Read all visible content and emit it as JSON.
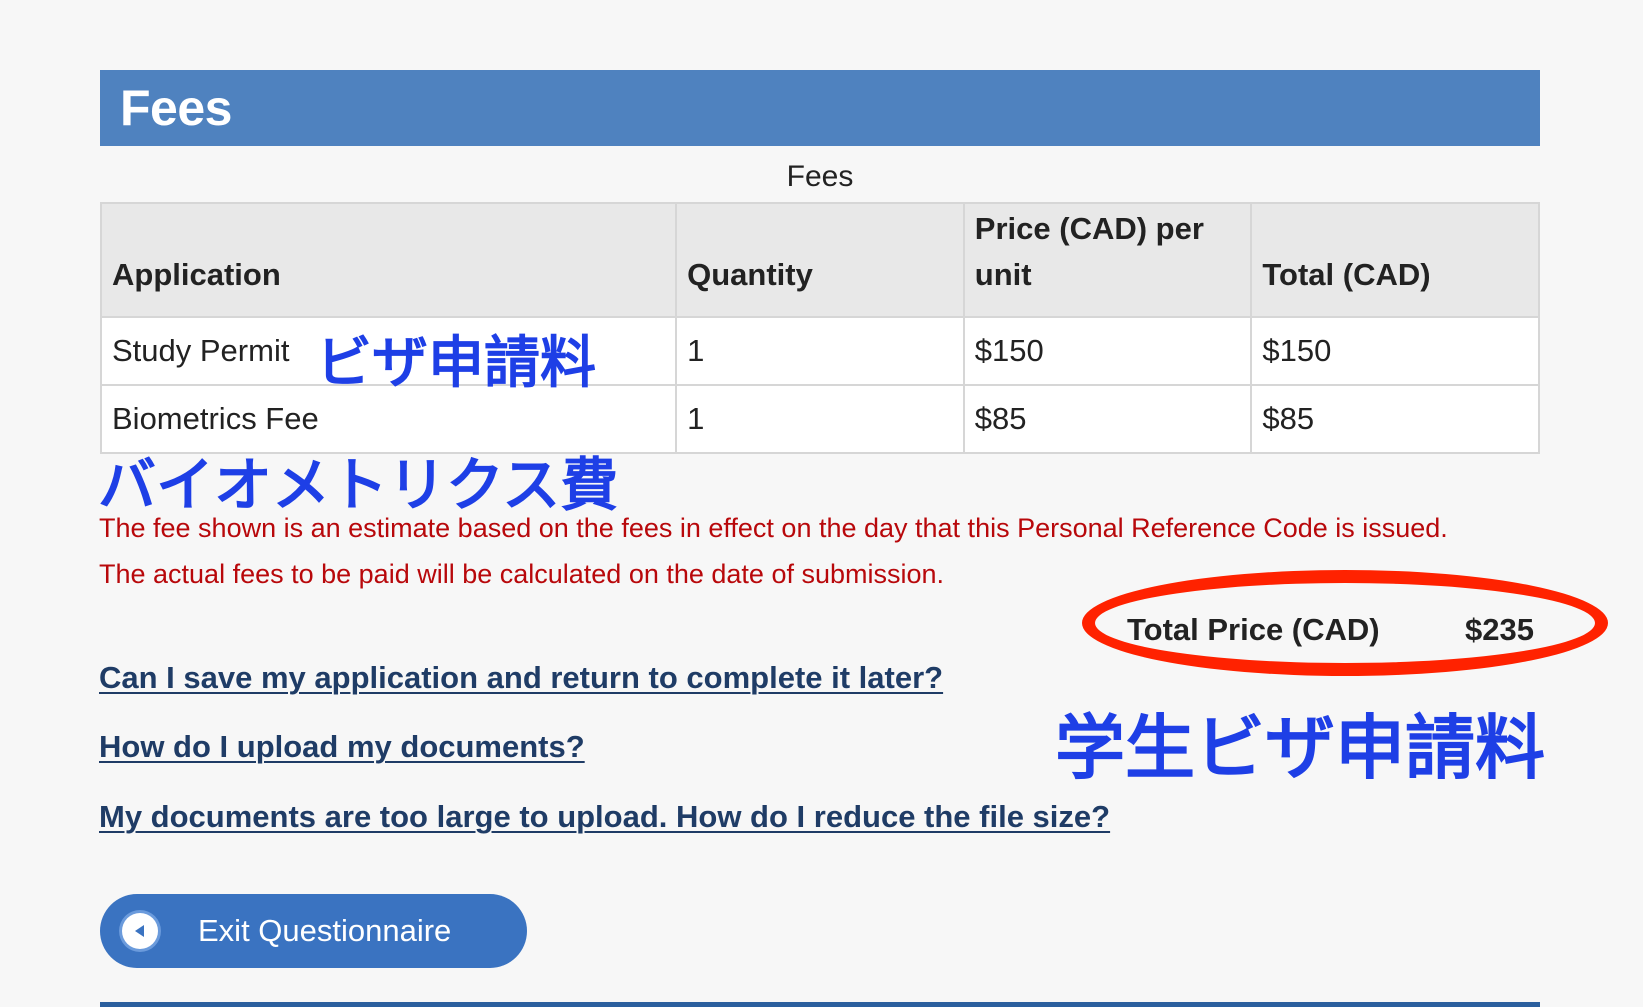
{
  "panel": {
    "title": "Fees"
  },
  "fees_table": {
    "caption": "Fees",
    "headers": {
      "application": "Application",
      "quantity": "Quantity",
      "price_per_unit": "Price (CAD) per unit",
      "total": "Total (CAD)"
    },
    "rows": [
      {
        "application": "Study Permit",
        "quantity": "1",
        "price_per_unit": "$150",
        "total": "$150"
      },
      {
        "application": "Biometrics Fee",
        "quantity": "1",
        "price_per_unit": "$85",
        "total": "$85"
      }
    ]
  },
  "annotations": {
    "visa_fee": "ビザ申請料",
    "biometrics_fee": "バイオメトリクス費",
    "student_visa_fee": "学生ビザ申請料",
    "text_color": "#1e3fe6",
    "highlight_color": "#ff2200"
  },
  "notice": {
    "line1": "The fee shown is an estimate based on the fees in effect on the day that this Personal Reference Code is issued.",
    "line2": "The actual fees to be paid will be calculated on the date of submission.",
    "color": "#b8080b"
  },
  "total_price": {
    "label": "Total Price (CAD)",
    "value": "$235"
  },
  "faq_links": [
    "Can I save my application and return to complete it later?",
    "How do I upload my documents?",
    "My documents are too large to upload. How do I reduce the file size?"
  ],
  "exit_button": {
    "label": "Exit Questionnaire",
    "icon": "arrow-left-circle-icon",
    "color": "#3a73c1"
  },
  "theme": {
    "header_color": "#4f82bf",
    "link_color": "#1f3c66"
  }
}
